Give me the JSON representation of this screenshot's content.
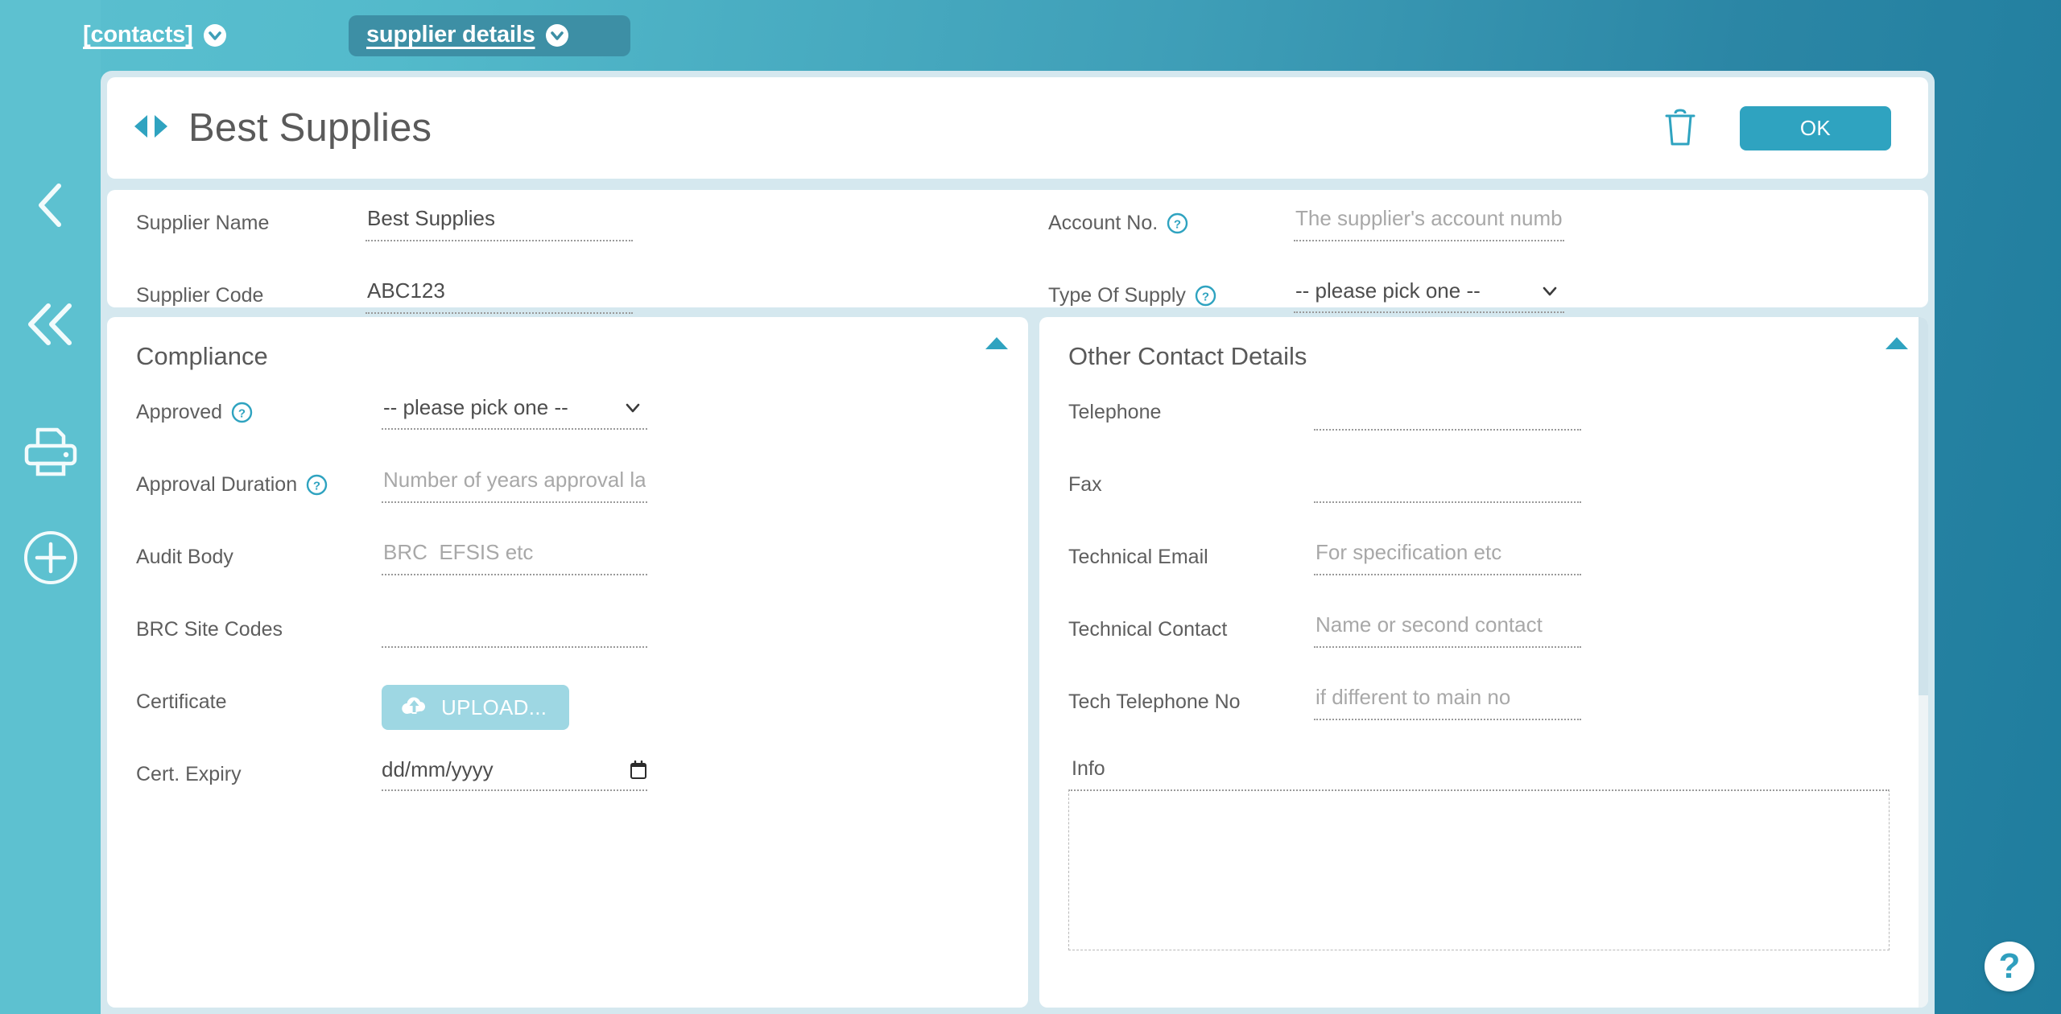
{
  "theme": {
    "accent": "#2fa3c0",
    "sidebar_bg": "#5dc1d0",
    "page_bg_start": "#5bc0d0",
    "page_bg_end": "#1f7d9e",
    "panel_bg": "#d5e8ef",
    "active_tab_bg": "#3d8fa5",
    "upload_bg": "#9ed7e3",
    "help_icon_color": "#2f9fbe"
  },
  "tabs": [
    {
      "label": "[contacts]",
      "icon": "chevron-down-circle-icon",
      "active": false
    },
    {
      "label": "supplier details",
      "icon": "chevron-down-circle-icon",
      "active": true
    }
  ],
  "sidebar": {
    "items": [
      {
        "icon": "chevron-left-icon",
        "name": "back"
      },
      {
        "icon": "chevron-double-left-icon",
        "name": "collapse"
      },
      {
        "icon": "printer-icon",
        "name": "print"
      },
      {
        "icon": "plus-circle-icon",
        "name": "add"
      }
    ]
  },
  "header": {
    "title": "Best Supplies",
    "prev_icon": "triangle-left-icon",
    "next_icon": "triangle-right-icon",
    "delete_icon": "trash-icon",
    "ok_label": "OK"
  },
  "top_panel": {
    "left_fields": [
      {
        "label": "Supplier Name",
        "value": "Best Supplies",
        "placeholder": "",
        "type": "text"
      },
      {
        "label": "Supplier Code",
        "value": "ABC123",
        "placeholder": "",
        "type": "text"
      }
    ],
    "right_fields": [
      {
        "label": "Account No.",
        "help": true,
        "value": "",
        "placeholder": "The supplier's account number for Castell Howell",
        "type": "text"
      },
      {
        "label": "Type Of Supply",
        "help": true,
        "value": "-- please pick one --",
        "placeholder": "",
        "type": "select"
      }
    ]
  },
  "compliance": {
    "title": "Compliance",
    "collapse_icon": "triangle-up-icon",
    "fields": [
      {
        "label": "Approved",
        "help": true,
        "value": "-- please pick one --",
        "placeholder": "",
        "type": "select"
      },
      {
        "label": "Approval Duration",
        "help": true,
        "value": "",
        "placeholder": "Number of years approval lasts for",
        "type": "text"
      },
      {
        "label": "Audit Body",
        "help": false,
        "value": "",
        "placeholder": "BRC  EFSIS etc",
        "type": "text"
      },
      {
        "label": "BRC Site Codes",
        "help": false,
        "value": "",
        "placeholder": "",
        "type": "text"
      },
      {
        "label": "Certificate",
        "help": false,
        "value": "",
        "placeholder": "",
        "type": "upload"
      },
      {
        "label": "Cert. Expiry",
        "help": false,
        "value": "",
        "placeholder": "dd/mm/yyyy",
        "type": "date"
      }
    ],
    "upload_label": "UPLOAD...",
    "upload_icon": "cloud-upload-icon",
    "date_placeholder": "dd/mm/yyyy",
    "calendar_icon": "calendar-icon"
  },
  "other_contact": {
    "title": "Other Contact Details",
    "collapse_icon": "triangle-up-icon",
    "fields": [
      {
        "label": "Telephone",
        "value": "",
        "placeholder": "",
        "type": "text"
      },
      {
        "label": "Fax",
        "value": "",
        "placeholder": "",
        "type": "text"
      },
      {
        "label": "Technical Email",
        "value": "",
        "placeholder": "For specification etc",
        "type": "text"
      },
      {
        "label": "Technical Contact",
        "value": "",
        "placeholder": "Name or second contact",
        "type": "text"
      },
      {
        "label": "Tech Telephone No",
        "value": "",
        "placeholder": "if different to main no",
        "type": "text"
      }
    ],
    "info_label": "Info",
    "info_value": "",
    "info_placeholder": ""
  },
  "help_fab": {
    "icon": "question-mark-icon",
    "glyph": "?"
  }
}
